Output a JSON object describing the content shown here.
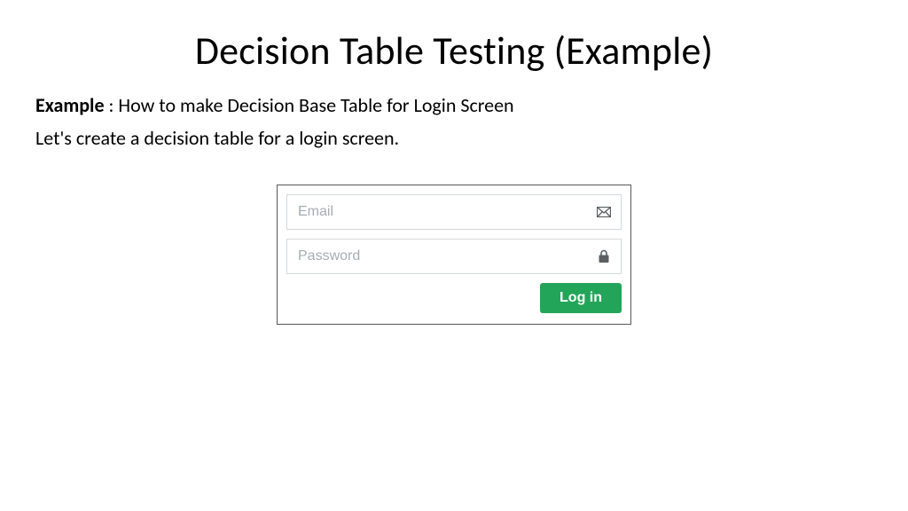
{
  "title": "Decision Table Testing (Example)",
  "intro": {
    "bold_label": "Example",
    "line1_rest": " : How to make Decision Base Table for Login Screen",
    "line2": "Let's create a decision table for a login screen."
  },
  "login_form": {
    "email_placeholder": "Email",
    "password_placeholder": "Password",
    "button_label": "Log in"
  }
}
